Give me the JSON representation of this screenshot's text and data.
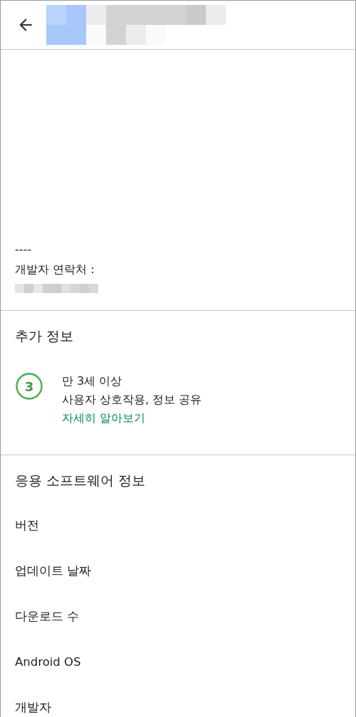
{
  "description": {
    "separator": "----",
    "contact_label": "개발자 연락처 :"
  },
  "additional_info": {
    "title": "추가 정보",
    "rating": {
      "badge": "3",
      "label": "만 3세 이상",
      "details": "사용자 상호작용, 정보 공유",
      "link": "자세히 알아보기"
    }
  },
  "app_info": {
    "title": "응용 소프트웨어 정보",
    "rows": [
      "버전",
      "업데이트 날짜",
      "다운로드 수",
      "Android OS",
      "개발자"
    ]
  }
}
